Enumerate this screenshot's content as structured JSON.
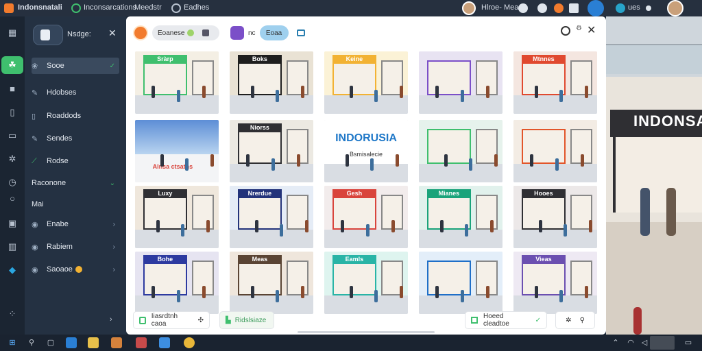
{
  "topbar": {
    "app_title": "Indonsnatali",
    "items": [
      "Inconsarcations",
      "Meedstr",
      "Eadhes"
    ],
    "right_label": "Hlroe- Meao",
    "right_label2": "ues"
  },
  "sidebar": {
    "header_label": "Nsdge:",
    "items": [
      {
        "label": "Sooe",
        "icon": "leaf-icon",
        "selected": true
      },
      {
        "label": "Hdobses",
        "icon": "edit-icon"
      },
      {
        "label": "Roaddods",
        "icon": "page-icon"
      },
      {
        "label": "Sendes",
        "icon": "edit-icon"
      },
      {
        "label": "Rodse",
        "icon": "check-icon"
      },
      {
        "label": "Raconone",
        "icon": "",
        "chevron": "down"
      },
      {
        "label": "Mai",
        "icon": ""
      },
      {
        "label": "Enabe",
        "icon": "circle-icon",
        "chevron": "right"
      },
      {
        "label": "Rabiem",
        "icon": "circle-icon",
        "chevron": "right"
      },
      {
        "label": "Saoaoe",
        "icon": "circle-icon",
        "chevron": "right"
      }
    ]
  },
  "panel": {
    "filter_pill": "Eoanese",
    "tab_label": "nc",
    "tab_pill": "Eoaa",
    "bottom": {
      "btn1": "Iiasrdtnh caoa",
      "btn2": "Ridslsiaze",
      "btn3": "Hoeed cleadtoe"
    }
  },
  "gallery": {
    "signs": [
      "Sràrp",
      "Boks",
      "Keine",
      "",
      "Mtnnes",
      "",
      "Niorss",
      "INDORUSIA",
      "",
      "",
      "Luxy",
      "Nrerdue",
      "Gesh",
      "Mianes",
      "Hooes",
      "Bohe",
      "Meas",
      "Eamls",
      "",
      "Vieas"
    ],
    "banner_text": "Bsmisalecie",
    "photo_caption": "Alnsa ctsatns"
  },
  "background": {
    "store_sign": "INDONSAI"
  },
  "colors": {
    "accent_green": "#3fbf6e",
    "panel_bg": "#ffffff",
    "sidebar_bg": "#243142"
  }
}
